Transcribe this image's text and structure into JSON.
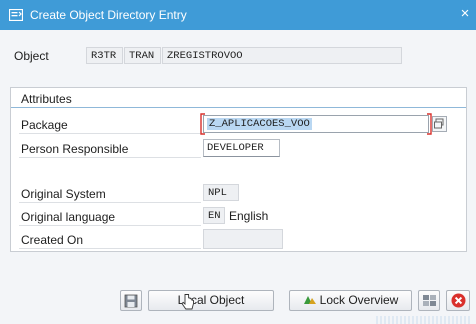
{
  "window": {
    "title": "Create Object Directory Entry",
    "close_glyph": "×"
  },
  "object": {
    "label": "Object",
    "values": [
      "R3TR",
      "TRAN",
      "ZREGISTROVOO"
    ]
  },
  "attributes": {
    "heading": "Attributes",
    "package": {
      "label": "Package",
      "value": "Z_APLICACOES_VOO"
    },
    "person": {
      "label": "Person Responsible",
      "value": "DEVELOPER"
    },
    "original_system": {
      "label": "Original System",
      "value": "NPL"
    },
    "original_language": {
      "label": "Original language",
      "code": "EN",
      "name": "English"
    },
    "created_on": {
      "label": "Created On",
      "value": ""
    }
  },
  "buttons": {
    "local_object": "Local Object",
    "lock_overview": "Lock Overview"
  },
  "colors": {
    "titlebar": "#3f9bd7",
    "selection": "#b9d7f2",
    "cancel": "#d9302c"
  }
}
